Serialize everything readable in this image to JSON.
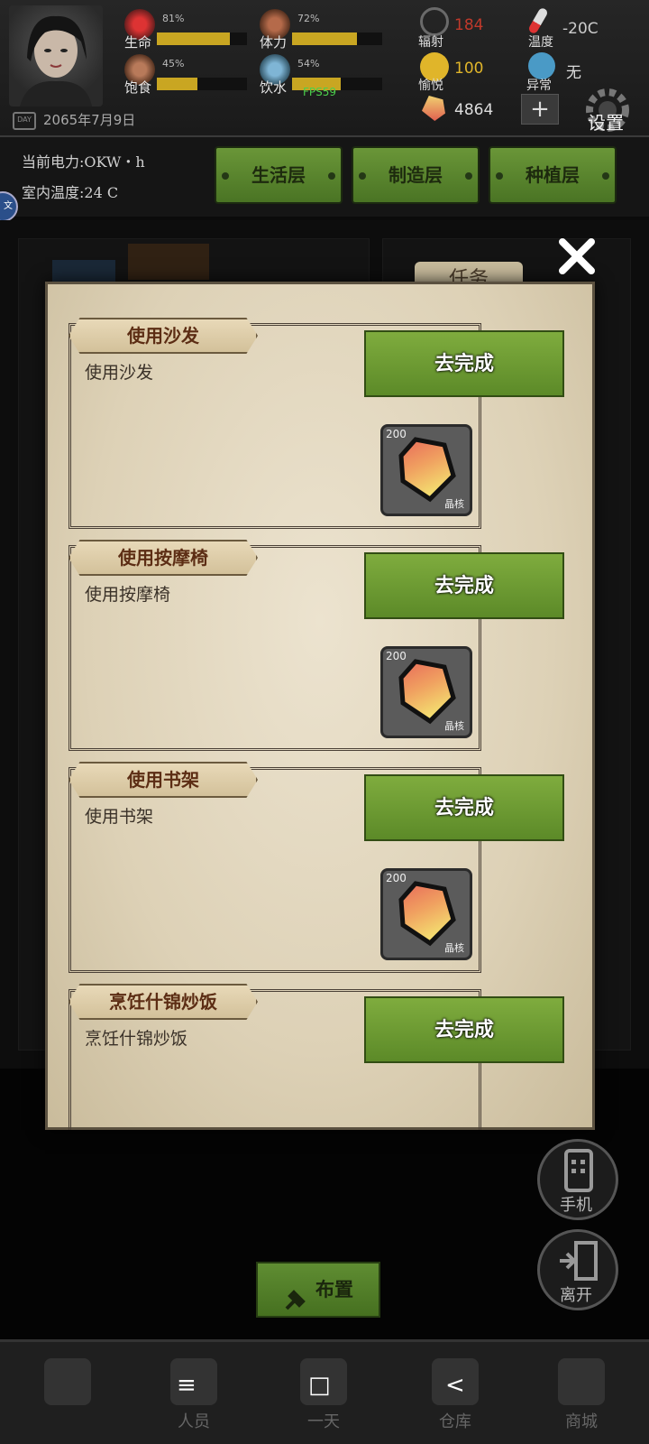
{
  "hud": {
    "stats": [
      {
        "label": "生命",
        "percent": "81%",
        "value": 0.81
      },
      {
        "label": "体力",
        "percent": "72%",
        "value": 0.72
      },
      {
        "label": "饱食",
        "percent": "45%",
        "value": 0.45
      },
      {
        "label": "饮水",
        "percent": "54%",
        "value": 0.54
      }
    ],
    "radiation_label": "辐射",
    "radiation_value": "184",
    "pleasure_label": "愉悦",
    "pleasure_value": "100",
    "crystal_value": "4864",
    "temperature_label": "温度",
    "temperature_value": "-20C",
    "abnormal_label": "异常",
    "abnormal_value": "无",
    "date": "2065年7月9日",
    "date_icon_text": "DAY",
    "fps": "FPS59",
    "plus": "+",
    "settings_label": "设置"
  },
  "infobar": {
    "power": "当前电力:OKW・h",
    "room_temp": "室内温度:24 C",
    "floors": [
      "生活层",
      "制造层",
      "种植层"
    ],
    "side_badge": "文"
  },
  "panel": {
    "tab_label": "任务",
    "tasks": [
      {
        "title": "使用沙发",
        "desc": "使用沙发",
        "button": "去完成",
        "reward_qty": "200",
        "reward_name": "晶核"
      },
      {
        "title": "使用按摩椅",
        "desc": "使用按摩椅",
        "button": "去完成",
        "reward_qty": "200",
        "reward_name": "晶核"
      },
      {
        "title": "使用书架",
        "desc": "使用书架",
        "button": "去完成",
        "reward_qty": "200",
        "reward_name": "晶核"
      },
      {
        "title": "烹饪什锦炒饭",
        "desc": "烹饪什锦炒饭",
        "button": "去完成"
      }
    ]
  },
  "controls": {
    "phone_label": "手机",
    "leave_label": "离开",
    "layout_label": "布置"
  },
  "bottom_nav": {
    "items": [
      "",
      "人员",
      "一天",
      "仓库",
      "商城"
    ],
    "system": [
      "≡",
      "□",
      "<"
    ]
  },
  "colors": {
    "button_green": "#6a9638",
    "parchment": "#e6dcc5",
    "bar_yellow": "#c9a622",
    "radiation_red": "#c0392b",
    "pleasure_yellow": "#e0b52a"
  }
}
